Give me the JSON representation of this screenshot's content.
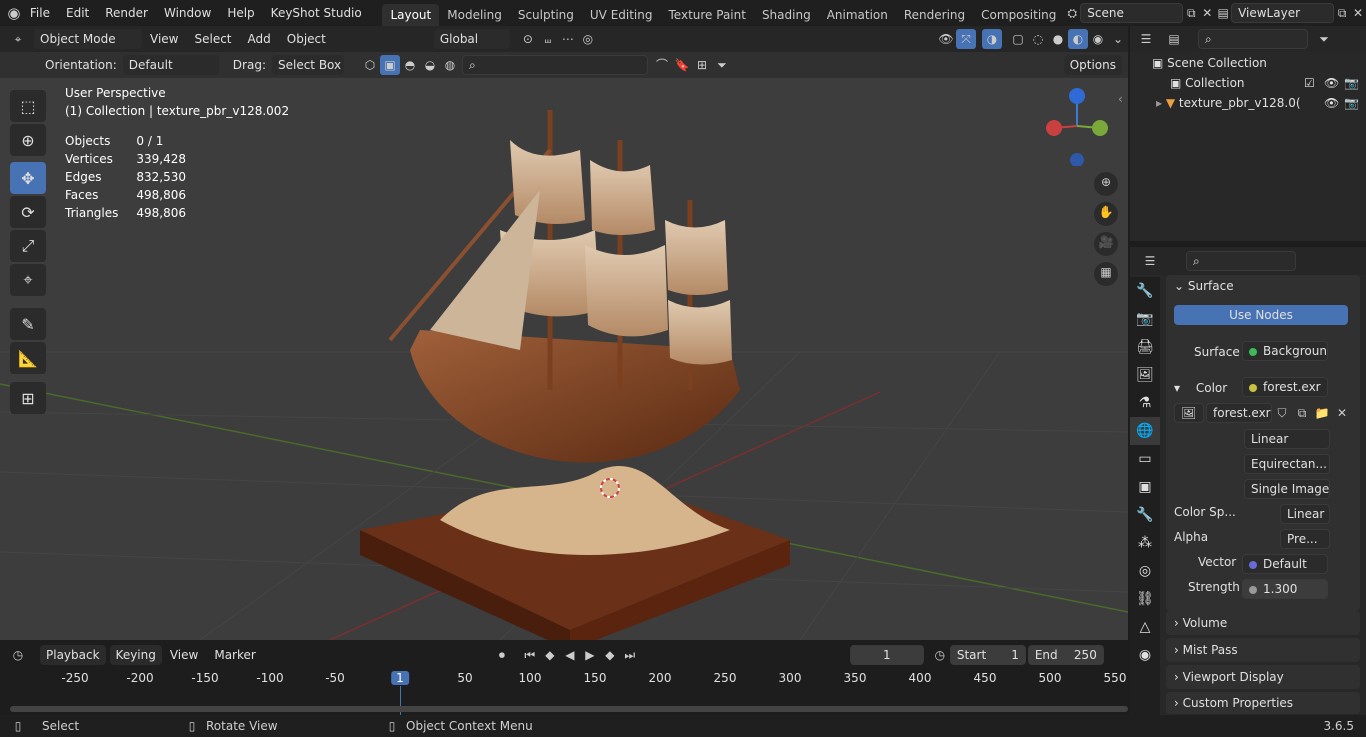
{
  "topbar": {
    "menus": [
      "File",
      "Edit",
      "Render",
      "Window",
      "Help",
      "KeyShot Studio"
    ],
    "workspaces": [
      "Layout",
      "Modeling",
      "Sculpting",
      "UV Editing",
      "Texture Paint",
      "Shading",
      "Animation",
      "Rendering",
      "Compositing"
    ],
    "active_workspace": "Layout",
    "scene": "Scene",
    "view_layer": "ViewLayer"
  },
  "vp_header": {
    "mode": "Object Mode",
    "menus": [
      "View",
      "Select",
      "Add",
      "Object"
    ],
    "transform": "Global",
    "orientation_label": "Orientation:",
    "orientation": "Default",
    "drag_label": "Drag:",
    "drag": "Select Box",
    "options": "Options"
  },
  "overlay": {
    "view_name": "User Perspective",
    "collection": "(1) Collection | texture_pbr_v128.002",
    "stats": [
      {
        "label": "Objects",
        "value": "0 / 1"
      },
      {
        "label": "Vertices",
        "value": "339,428"
      },
      {
        "label": "Edges",
        "value": "832,530"
      },
      {
        "label": "Faces",
        "value": "498,806"
      },
      {
        "label": "Triangles",
        "value": "498,806"
      }
    ]
  },
  "outliner": {
    "root": "Scene Collection",
    "collection": "Collection",
    "object": "texture_pbr_v128.0("
  },
  "properties": {
    "surface_header": "Surface",
    "use_nodes": "Use Nodes",
    "surface_label": "Surface",
    "surface_value": "Background",
    "color_label": "Color",
    "color_value": "forest.exr",
    "image_name": "forest.exr",
    "interp": "Linear",
    "projection": "Equirectan...",
    "source": "Single Image",
    "colorspace_label": "Color Sp...",
    "colorspace": "Linear",
    "alpha_label": "Alpha",
    "alpha": "Pre...",
    "vector_label": "Vector",
    "vector": "Default",
    "strength_label": "Strength",
    "strength": "1.300",
    "panels": [
      "Volume",
      "Mist Pass",
      "Viewport Display",
      "Custom Properties"
    ],
    "accent": "#4772b3"
  },
  "timeline": {
    "menus": [
      "Playback",
      "Keying",
      "View",
      "Marker"
    ],
    "current_frame": "1",
    "start_label": "Start",
    "start": "1",
    "end_label": "End",
    "end": "250",
    "ticks": [
      "-250",
      "-200",
      "-150",
      "-100",
      "-50",
      "1",
      "50",
      "100",
      "150",
      "200",
      "250",
      "300",
      "350",
      "400",
      "450",
      "500",
      "550"
    ],
    "playhead": "1"
  },
  "statusbar": {
    "select": "Select",
    "rotate": "Rotate View",
    "context": "Object Context Menu",
    "version": "3.6.5"
  }
}
